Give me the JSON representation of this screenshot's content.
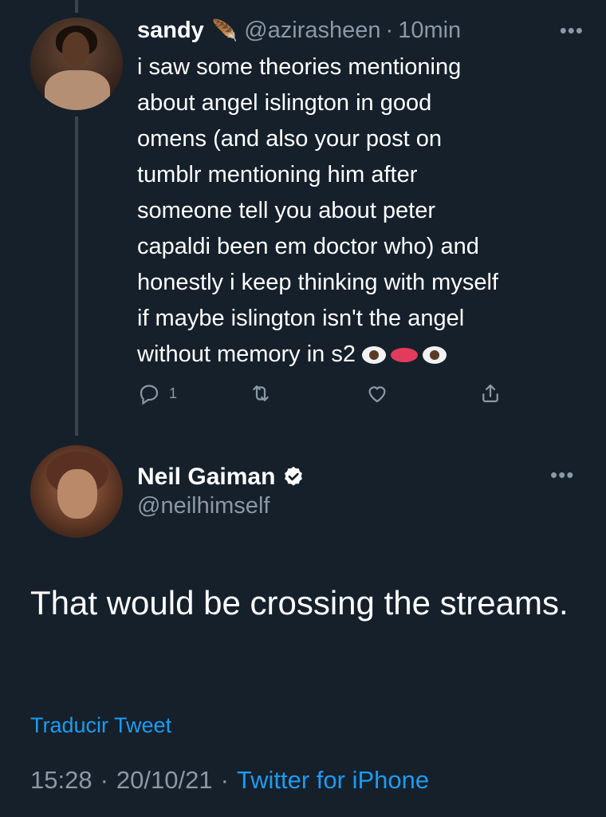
{
  "reply_tweet": {
    "author_name": "sandy",
    "author_emoji": "🪶",
    "handle": "@azirasheen",
    "time": "10min",
    "text": "i saw some theories mentioning\nabout angel islington in good\nomens (and also your post on\ntumblr mentioning him after\nsomeone tell you about peter\ncapaldi been em doctor who) and\nhonestly i keep thinking with myself\nif maybe islington isn't the angel\nwithout memory in s2",
    "reply_count": "1",
    "icons": [
      "reply-icon",
      "retweet-icon",
      "like-icon",
      "share-icon"
    ]
  },
  "main_tweet": {
    "author_name": "Neil Gaiman",
    "handle": "@neilhimself",
    "text": "That would be crossing the streams.",
    "translate_label": "Traducir Tweet",
    "time": "15:28",
    "date": "20/10/21",
    "source": "Twitter for iPhone"
  },
  "colors": {
    "background": "#15202b",
    "secondary_text": "#8b98a5",
    "link": "#1d9bf0",
    "thread_line": "#38444d"
  }
}
